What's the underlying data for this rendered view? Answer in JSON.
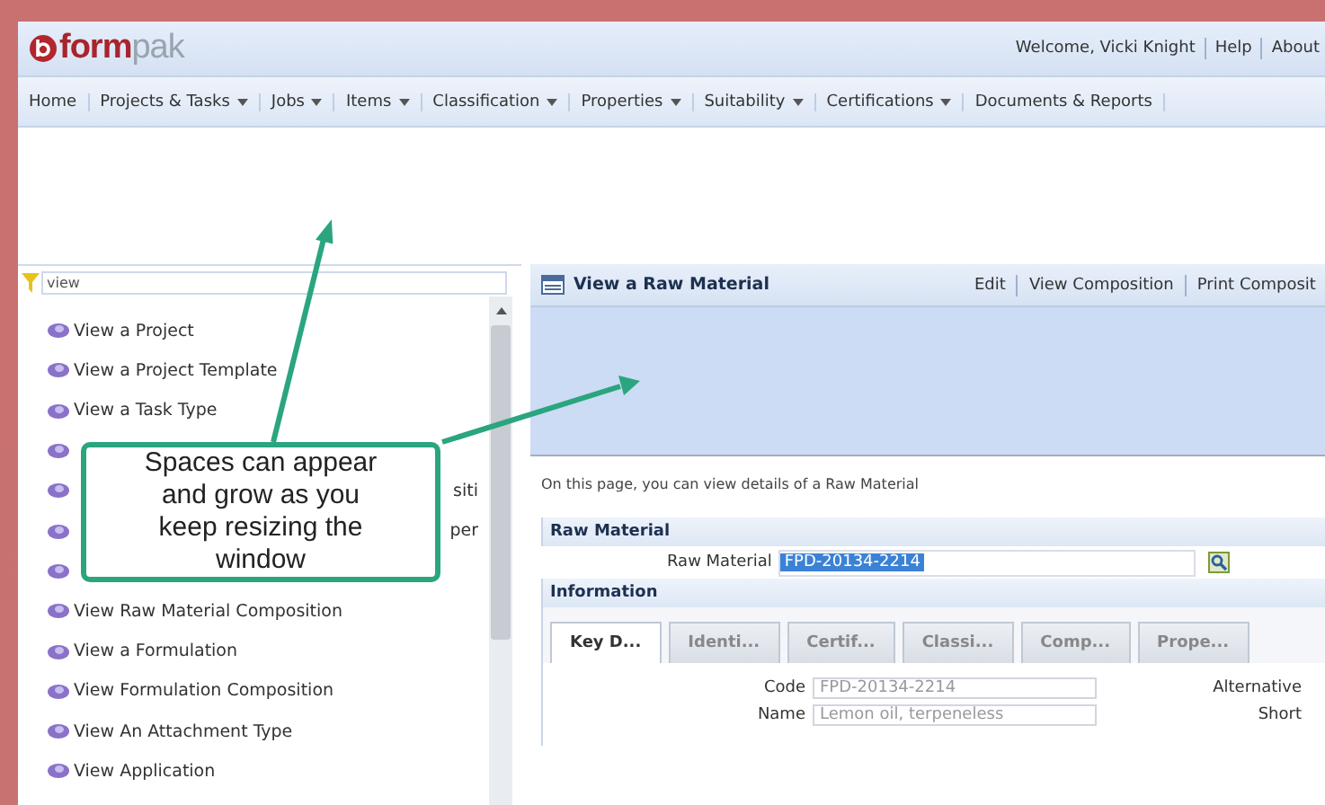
{
  "header": {
    "logo": {
      "primary": "form",
      "secondary": "pak"
    },
    "links": [
      "Welcome, Vicki Knight",
      "Help",
      "About"
    ]
  },
  "nav": [
    {
      "label": "Home",
      "has_menu": false
    },
    {
      "label": "Projects & Tasks",
      "has_menu": true
    },
    {
      "label": "Jobs",
      "has_menu": true
    },
    {
      "label": "Items",
      "has_menu": true
    },
    {
      "label": "Classification",
      "has_menu": true
    },
    {
      "label": "Properties",
      "has_menu": true
    },
    {
      "label": "Suitability",
      "has_menu": true
    },
    {
      "label": "Certifications",
      "has_menu": true
    },
    {
      "label": "Documents & Reports",
      "has_menu": false
    }
  ],
  "sidebar": {
    "search": {
      "value": "view"
    },
    "items": [
      {
        "kind": "full",
        "label": "View a Project"
      },
      {
        "kind": "full",
        "label": "View a Project Template"
      },
      {
        "kind": "full",
        "label": "View a Task Type"
      },
      {
        "kind": "covered"
      },
      {
        "kind": "covered",
        "label": "siti"
      },
      {
        "kind": "covered",
        "label": "per"
      },
      {
        "kind": "covered"
      },
      {
        "kind": "full",
        "label": "View Raw Material Composition"
      },
      {
        "kind": "full",
        "label": "View a Formulation"
      },
      {
        "kind": "full",
        "label": "View Formulation Composition"
      },
      {
        "kind": "full",
        "label": "View An Attachment Type"
      },
      {
        "kind": "full",
        "label": "View Application"
      }
    ]
  },
  "callout": {
    "text": "Spaces can appear and grow as you keep resizing the window"
  },
  "main": {
    "title": "View a Raw Material",
    "actions": [
      "Edit",
      "View Composition",
      "Print Composit"
    ],
    "intro": "On this page, you can view details of a Raw Material",
    "raw_material_section": {
      "heading": "Raw Material",
      "field_label": "Raw Material",
      "field_value": "FPD-20134-2214"
    },
    "information_section": {
      "heading": "Information",
      "tabs": [
        {
          "label": "Key D...",
          "selected": true
        },
        {
          "label": "Identi...",
          "selected": false
        },
        {
          "label": "Certif...",
          "selected": false
        },
        {
          "label": "Classi...",
          "selected": false
        },
        {
          "label": "Comp...",
          "selected": false
        },
        {
          "label": "Prope...",
          "selected": false
        }
      ],
      "fields": [
        {
          "label": "Code",
          "value": "FPD-20134-2214",
          "side_label": "Alternative"
        },
        {
          "label": "Name",
          "value": "Lemon oil, terpeneless",
          "side_label": "Short"
        }
      ]
    }
  }
}
